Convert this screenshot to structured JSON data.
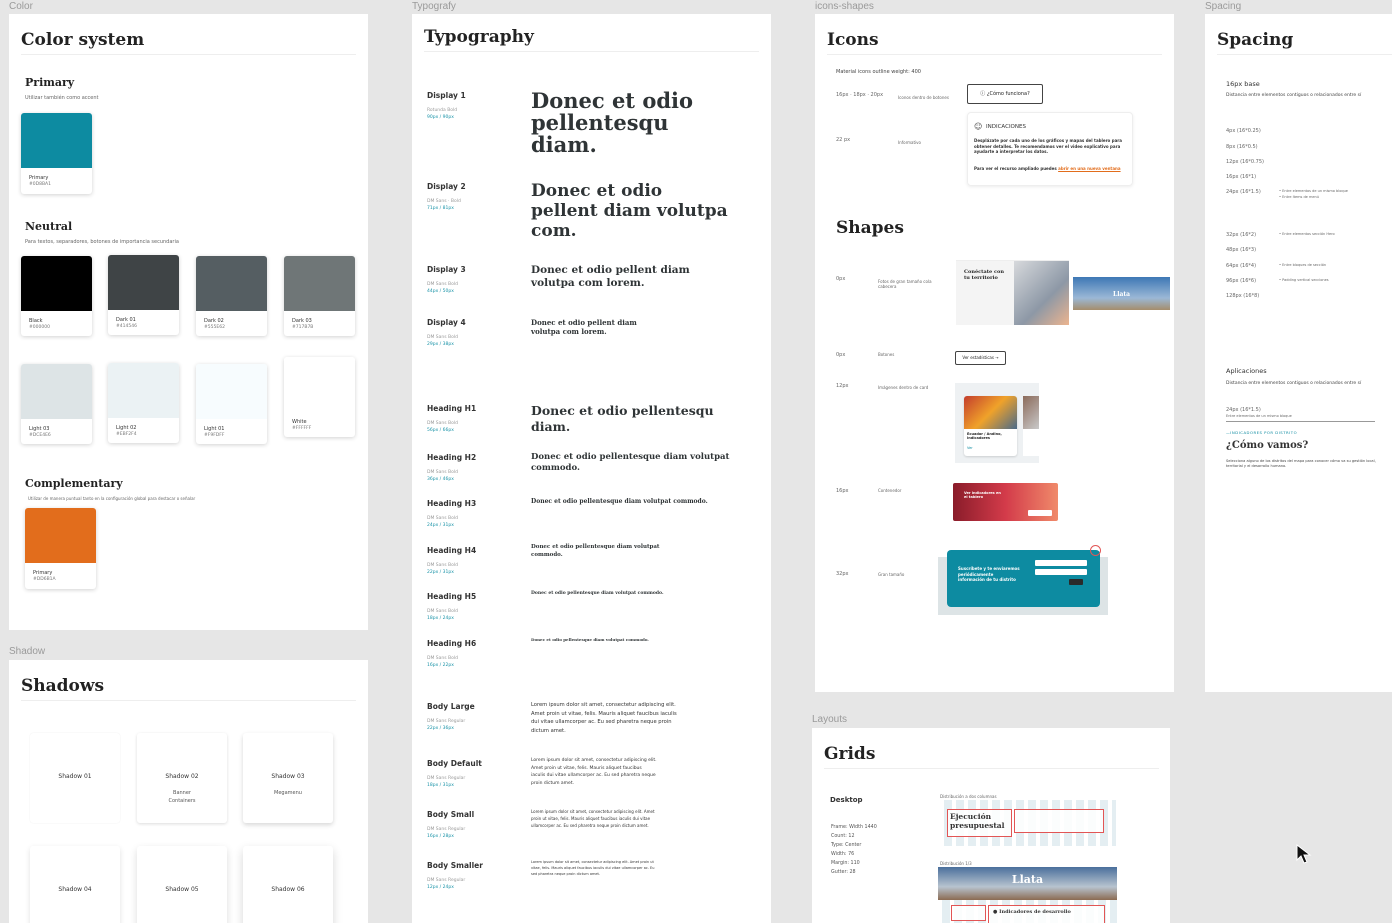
{
  "labels": {
    "color": "Color",
    "typo": "Typografy",
    "icons": "icons-shapes",
    "spacing": "Spacing",
    "shadow": "Shadow",
    "layouts": "Layouts"
  },
  "color": {
    "title": "Color system",
    "primary": {
      "heading": "Primary",
      "desc": "Utilizar también como accent",
      "swatch": {
        "name": "Primary",
        "value": "#0D8BA1",
        "color": "#0d8ba1"
      }
    },
    "neutral": {
      "heading": "Neutral",
      "desc": "Para textos, separadores, botones de importancia secundaria",
      "row1": [
        {
          "name": "Black",
          "value": "#000000",
          "color": "#000000"
        },
        {
          "name": "Dark 01",
          "value": "#414546",
          "color": "#3f4446"
        },
        {
          "name": "Dark 02",
          "value": "#555E62",
          "color": "#555e62"
        },
        {
          "name": "Dark 03",
          "value": "#717B7B",
          "color": "#6f7677"
        }
      ],
      "row2": [
        {
          "name": "Light 03",
          "value": "#DCE4E6",
          "color": "#dde4e6"
        },
        {
          "name": "Light 02",
          "value": "#EBF2F4",
          "color": "#ebf2f4"
        },
        {
          "name": "Light 01",
          "value": "#F9FDFF",
          "color": "#f7fcfe"
        },
        {
          "name": "White",
          "value": "#FFFFFF",
          "color": "#ffffff"
        }
      ]
    },
    "complementary": {
      "heading": "Complementary",
      "desc": "Utilizar de manera puntual tanto en la configuración global para destacar o señalar",
      "swatch": {
        "name": "Primary",
        "value": "#DD6B1A",
        "color": "#e26d1c"
      }
    }
  },
  "shadows": {
    "title": "Shadows",
    "cards": [
      {
        "title": "Shadow 01",
        "sub": ""
      },
      {
        "title": "Shadow 02",
        "sub": "Banner\nContainers"
      },
      {
        "title": "Shadow 03",
        "sub": "Megamenu"
      },
      {
        "title": "Shadow 04",
        "sub": ""
      },
      {
        "title": "Shadow 05",
        "sub": ""
      },
      {
        "title": "Shadow 06",
        "sub": ""
      }
    ]
  },
  "typography": {
    "title": "Typography",
    "rows": [
      {
        "name": "Display 1",
        "font": "Rotunda Bold",
        "size": "90px / 90px",
        "sample": "Donec et odio pellentesqu diam."
      },
      {
        "name": "Display 2",
        "font": "DM Sans  ·  Bold",
        "size": "71px / 81px",
        "sample": "Donec et odio pellent diam volutpa com."
      },
      {
        "name": "Display 3",
        "font": "DM Sans Bold",
        "size": "44px / 50px",
        "sample": "Donec et odio pellent diam volutpa com lorem."
      },
      {
        "name": "Display 4",
        "font": "DM Sans Bold",
        "size": "29px / 38px",
        "sample": "Donec et odio pellent diam volutpa com lorem."
      },
      {
        "name": "Heading H1",
        "font": "DM Sans Bold",
        "size": "56px / 66px",
        "sample": "Donec et odio pellentesqu diam."
      },
      {
        "name": "Heading H2",
        "font": "DM Sans Bold",
        "size": "36px / 46px",
        "sample": "Donec et odio pellentesque diam volutpat commodo."
      },
      {
        "name": "Heading H3",
        "font": "DM Sans Bold",
        "size": "24px / 31px",
        "sample": "Donec et odio pellentesque diam volutpat commodo."
      },
      {
        "name": "Heading H4",
        "font": "DM Sans Bold",
        "size": "22px / 31px",
        "sample": "Donec et odio pellentesque diam volutpat commodo."
      },
      {
        "name": "Heading H5",
        "font": "DM Sans Bold",
        "size": "18px / 24px",
        "sample": "Donec et odio pellentesque diam volutpat commodo."
      },
      {
        "name": "Heading H6",
        "font": "DM Sans Bold",
        "size": "16px / 22px",
        "sample": "Donec et odio pellentesque diam volutpat commodo."
      },
      {
        "name": "Body Large",
        "font": "DM Sans Regular",
        "size": "22px / 36px",
        "sample": "Lorem ipsum dolor sit amet, consectetur adipiscing elit. Amet proin ut vitae, felis. Mauris aliquet faucibus iaculis dui vitae ullamcorper ac. Eu sed pharetra neque proin dictum amet."
      },
      {
        "name": "Body Default",
        "font": "DM Sans Regular",
        "size": "18px / 31px",
        "sample": "Lorem ipsum dolor sit amet, consectetur adipiscing elit. Amet proin ut vitae, felis. Mauris aliquet faucibus iaculis dui vitae ullamcorper ac. Eu sed pharetra neque proin dictum amet."
      },
      {
        "name": "Body Small",
        "font": "DM Sans Regular",
        "size": "16px / 28px",
        "sample": "Lorem ipsum dolor sit amet, consectetur adipiscing elit. Amet proin ut vitae, felis. Mauris aliquet faucibus iaculis dui vitae ullamcorper ac. Eu sed pharetra neque proin dictum amet."
      },
      {
        "name": "Body Smaller",
        "font": "DM Sans Regular",
        "size": "12px / 24px",
        "sample": "Lorem ipsum dolor sit amet, consectetur adipiscing elit. Amet proin ut vitae, felis. Mauris aliquet faucibus iaculis dui vitae ullamcorper ac. Eu sed pharetra neque proin dictum amet."
      }
    ]
  },
  "icons": {
    "title": "Icons",
    "desc": "Material icons outline weight: 400",
    "row1": {
      "size": "16px · 18px · 20px",
      "use": "Iconos dentro de botones",
      "button": "¿Cómo funciona?"
    },
    "row2": {
      "size": "22 px",
      "use": "Informativo",
      "panel_title": "INDICACIONES",
      "panel_text": "Desplázate por cada uno de los gráficos y mapas del tablero para obtener detalles. Te recomendamos ver el video explicativo para ayudarte a interpretar los datos.",
      "panel_more": "Para ver el recurso ampliado puedes",
      "panel_link": "abrir en una nueva ventana"
    }
  },
  "shapes": {
    "title": "Shapes",
    "rows": [
      {
        "radius": "0px",
        "use": "Fotos de gran tamaño cola cabecera",
        "img1": "Conéctate con tu territorio",
        "img2": "Llata"
      },
      {
        "radius": "0px",
        "use": "Botones",
        "button": "Ver estadísticas →"
      },
      {
        "radius": "12px",
        "use": "Imágenes dentro de card",
        "card_text": "Ecuador / Andino, indicadores",
        "card_link": "Ver"
      },
      {
        "radius": "16px",
        "use": "Contenedor",
        "banner_text": "Ver indicadores en el tablero"
      },
      {
        "radius": "32px",
        "use": "Gran tamaño",
        "box_text": "Suscríbete y te enviaremos periódicamente información de tu distrito"
      }
    ]
  },
  "spacing": {
    "title": "Spacing",
    "base": {
      "heading": "16px base",
      "desc": "Distancia entre elementos contiguos o relacionados entre sí"
    },
    "items": [
      {
        "size": "4px (16*0.25)",
        "note": ""
      },
      {
        "size": "8px (16*0.5)",
        "note": ""
      },
      {
        "size": "12px (16*0.75)",
        "note": ""
      },
      {
        "size": "16px (16*1)",
        "note": ""
      },
      {
        "size": "24px (16*1.5)",
        "note": "• Entre elementos de un mismo bloque\n• Entre ítems de menú"
      },
      {
        "size": "32px (16*2)",
        "note": "• Entre elementos sección Hero"
      },
      {
        "size": "48px (16*3)",
        "note": ""
      },
      {
        "size": "64px (16*4)",
        "note": "• Entre bloques de sección"
      },
      {
        "size": "96px (16*6)",
        "note": "• Padding vertical secciones"
      },
      {
        "size": "128px (16*8)",
        "note": ""
      }
    ],
    "applications": {
      "heading": "Aplicaciones",
      "desc": "Distancia entre elementos contiguos o relacionados entre sí",
      "example_size": "24px (16*1.5)",
      "example_note": "Entre elementos de un mismo bloque",
      "overline": "INDICADORES POR DISTRITO",
      "q_title": "¿Cómo vamos?",
      "q_text": "Selecciona alguno de los distritos del mapa para conocer cómo va su gestión local, territorial y el desarrollo humano."
    }
  },
  "grids": {
    "title": "Grids",
    "desktop": "Desktop",
    "specs": [
      "Frame: Width 1440",
      "Count: 12",
      "Type: Center",
      "Width: 76",
      "Margin: 110",
      "Gutter: 28"
    ],
    "dist1": "Distribución a dos columnas",
    "dist2": "Distribución 1/3",
    "img1": "Ejecución presupuestal",
    "img2": "Llata",
    "img3": "Indicadores de desarrollo"
  }
}
